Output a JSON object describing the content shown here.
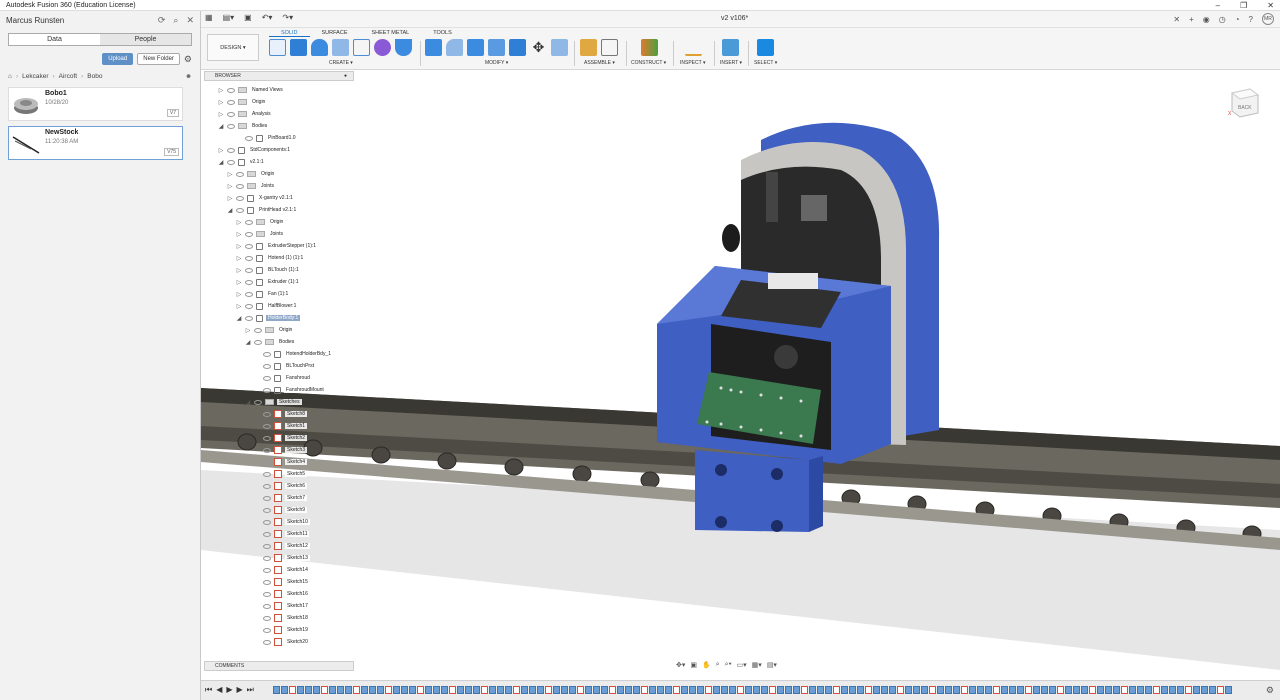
{
  "window": {
    "title": "Autodesk Fusion 360 (Education License)"
  },
  "datapanel": {
    "user": "Marcus Runsten",
    "tabs": [
      "Data",
      "People"
    ],
    "upload_label": "Upload",
    "new_folder_label": "New Folder",
    "breadcrumb": [
      "Lekcaker",
      "Aircoft",
      "Bobo"
    ],
    "files": [
      {
        "name": "Bobo1",
        "date": "10/28/20",
        "version": "V7"
      },
      {
        "name": "NewStock",
        "date": "11:20:38 AM",
        "version": "V75"
      }
    ]
  },
  "toolbar": {
    "doc_tab": "v2 v106*",
    "design_label": "DESIGN ▾",
    "workspace_tabs": [
      "SOLID",
      "SURFACE",
      "SHEET METAL",
      "TOOLS"
    ],
    "groups": [
      "CREATE ▾",
      "MODIFY ▾",
      "ASSEMBLE ▾",
      "CONSTRUCT ▾",
      "INSPECT ▾",
      "INSERT ▾",
      "SELECT ▾"
    ],
    "avatar": "MR"
  },
  "browser": {
    "title": "BROWSER",
    "comments": "COMMENTS",
    "rows": [
      {
        "label": "Named Views",
        "indent": 0,
        "icon": "folder",
        "caret": "▷"
      },
      {
        "label": "Origin",
        "indent": 0,
        "icon": "folder",
        "caret": "▷"
      },
      {
        "label": "Analysis",
        "indent": 0,
        "icon": "folder",
        "caret": "▷"
      },
      {
        "label": "Bodies",
        "indent": 0,
        "icon": "folder",
        "caret": "◢"
      },
      {
        "label": "PinBoard1.0",
        "indent": 2,
        "icon": "comp",
        "caret": ""
      },
      {
        "label": "StdComponents:1",
        "indent": 0,
        "icon": "comp",
        "caret": "▷"
      },
      {
        "label": "v2.1:1",
        "indent": 0,
        "icon": "comp",
        "caret": "◢"
      },
      {
        "label": "Origin",
        "indent": 1,
        "icon": "folder",
        "caret": "▷"
      },
      {
        "label": "Joints",
        "indent": 1,
        "icon": "folder",
        "caret": "▷"
      },
      {
        "label": "X-gantry v2.1:1",
        "indent": 1,
        "icon": "comp",
        "caret": "▷"
      },
      {
        "label": "PrintHead v2.1:1",
        "indent": 1,
        "icon": "comp",
        "caret": "◢"
      },
      {
        "label": "Origin",
        "indent": 2,
        "icon": "folder",
        "caret": "▷"
      },
      {
        "label": "Joints",
        "indent": 2,
        "icon": "folder",
        "caret": "▷"
      },
      {
        "label": "ExtruderStepper (1):1",
        "indent": 2,
        "icon": "comp",
        "caret": "▷"
      },
      {
        "label": "Hotend (1) (1):1",
        "indent": 2,
        "icon": "comp",
        "caret": "▷"
      },
      {
        "label": "BLTouch (1):1",
        "indent": 2,
        "icon": "comp",
        "caret": "▷"
      },
      {
        "label": "Extruder (1):1",
        "indent": 2,
        "icon": "comp",
        "caret": "▷"
      },
      {
        "label": "Fan (1):1",
        "indent": 2,
        "icon": "comp",
        "caret": "▷"
      },
      {
        "label": "HalfBlower:1",
        "indent": 2,
        "icon": "comp",
        "caret": "▷"
      },
      {
        "label": "HolderBody:1",
        "indent": 2,
        "icon": "comp",
        "caret": "◢",
        "highlight": true
      },
      {
        "label": "Origin",
        "indent": 3,
        "icon": "folder",
        "caret": "▷"
      },
      {
        "label": "Bodies",
        "indent": 3,
        "icon": "folder",
        "caret": "◢"
      },
      {
        "label": "HotendHolderBdy_1",
        "indent": 4,
        "icon": "comp",
        "caret": ""
      },
      {
        "label": "BLTouchPrst",
        "indent": 4,
        "icon": "comp",
        "caret": ""
      },
      {
        "label": "Fanshroud",
        "indent": 4,
        "icon": "comp",
        "caret": ""
      },
      {
        "label": "FanshroudMount",
        "indent": 4,
        "icon": "comp",
        "caret": ""
      },
      {
        "label": "Sketches",
        "indent": 3,
        "icon": "folder",
        "caret": "◢"
      },
      {
        "label": "Sketch8",
        "indent": 4,
        "icon": "sketch",
        "caret": ""
      },
      {
        "label": "Sketch1",
        "indent": 4,
        "icon": "sketch",
        "caret": ""
      },
      {
        "label": "Sketch2",
        "indent": 4,
        "icon": "sketch",
        "caret": ""
      },
      {
        "label": "Sketch3",
        "indent": 4,
        "icon": "sketch",
        "caret": ""
      },
      {
        "label": "Sketch4",
        "indent": 4,
        "icon": "sketch",
        "caret": ""
      },
      {
        "label": "Sketch5",
        "indent": 4,
        "icon": "sketch",
        "caret": ""
      },
      {
        "label": "Sketch6",
        "indent": 4,
        "icon": "sketch",
        "caret": ""
      },
      {
        "label": "Sketch7",
        "indent": 4,
        "icon": "sketch",
        "caret": ""
      },
      {
        "label": "Sketch9",
        "indent": 4,
        "icon": "sketch",
        "caret": ""
      },
      {
        "label": "Sketch10",
        "indent": 4,
        "icon": "sketch",
        "caret": ""
      },
      {
        "label": "Sketch11",
        "indent": 4,
        "icon": "sketch",
        "caret": ""
      },
      {
        "label": "Sketch12",
        "indent": 4,
        "icon": "sketch",
        "caret": ""
      },
      {
        "label": "Sketch13",
        "indent": 4,
        "icon": "sketch",
        "caret": ""
      },
      {
        "label": "Sketch14",
        "indent": 4,
        "icon": "sketch",
        "caret": ""
      },
      {
        "label": "Sketch15",
        "indent": 4,
        "icon": "sketch",
        "caret": ""
      },
      {
        "label": "Sketch16",
        "indent": 4,
        "icon": "sketch",
        "caret": ""
      },
      {
        "label": "Sketch17",
        "indent": 4,
        "icon": "sketch",
        "caret": ""
      },
      {
        "label": "Sketch18",
        "indent": 4,
        "icon": "sketch",
        "caret": ""
      },
      {
        "label": "Sketch19",
        "indent": 4,
        "icon": "sketch",
        "caret": ""
      },
      {
        "label": "Sketch20",
        "indent": 4,
        "icon": "sketch",
        "caret": ""
      }
    ]
  },
  "viewcube": {
    "face": "BACK"
  },
  "colors": {
    "accent": "#1a72c7",
    "part_blue": "#3f5fc2",
    "rail": "#6b685f",
    "pcb": "#3b7a4f"
  }
}
